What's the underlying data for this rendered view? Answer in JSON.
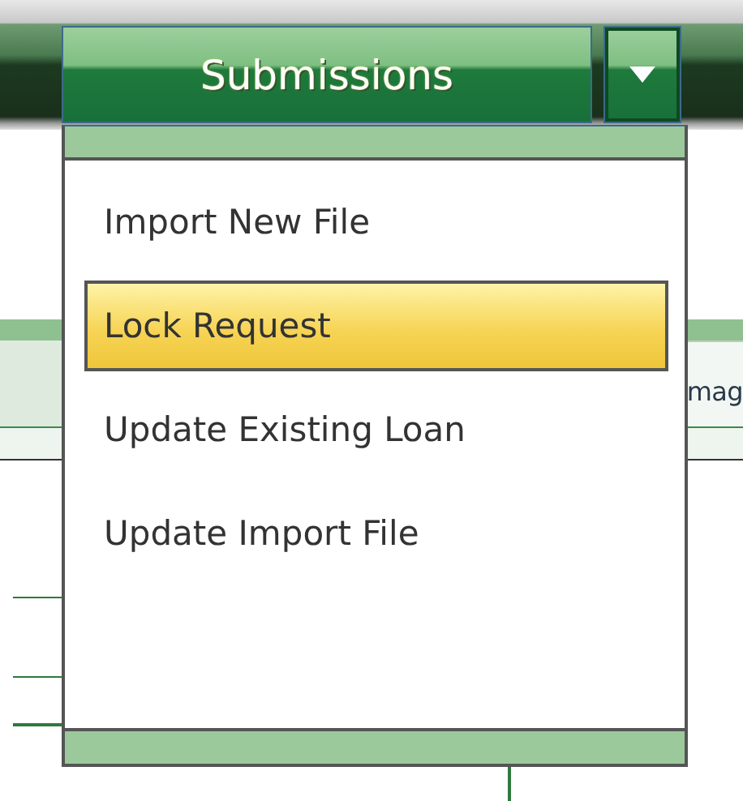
{
  "toolbar": {
    "button": {
      "label": "Submissions",
      "expanded": true
    }
  },
  "menu": {
    "items": [
      {
        "label": "Import New File",
        "selected": false
      },
      {
        "label": "Lock Request",
        "selected": true
      },
      {
        "label": "Update Existing Loan",
        "selected": false
      },
      {
        "label": "Update Import File",
        "selected": false
      }
    ]
  },
  "tabs": [
    {
      "label": "mag",
      "selected": true
    }
  ]
}
